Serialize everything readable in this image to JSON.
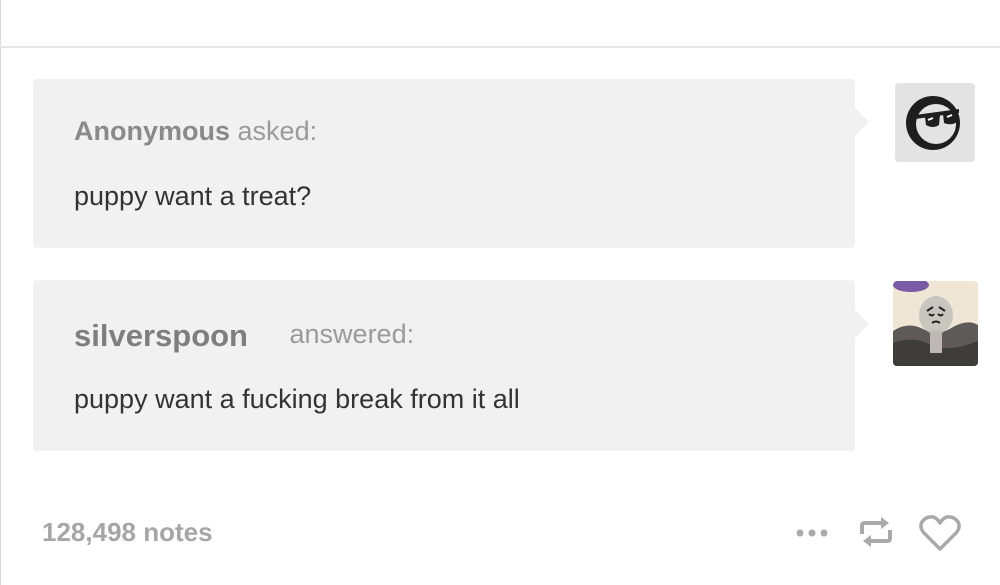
{
  "ask": {
    "asker": "Anonymous",
    "verb": "asked:",
    "question": "puppy want a treat?",
    "avatar_icon": "sunglasses-avatar"
  },
  "answer": {
    "answerer": "silverspoon",
    "verb": "answered:",
    "text": "puppy want a fucking break from it all",
    "avatar_icon": "silverspoon-character-avatar"
  },
  "footer": {
    "notes": "128,498 notes",
    "actions": [
      "more-icon",
      "reblog-icon",
      "heart-icon"
    ]
  },
  "colors": {
    "bubble": "#f1f1f1",
    "muted_text": "#8e8e8e",
    "body_text": "#333333",
    "notes_text": "#a6a6a6",
    "icon_gray": "#a9a9a9"
  }
}
